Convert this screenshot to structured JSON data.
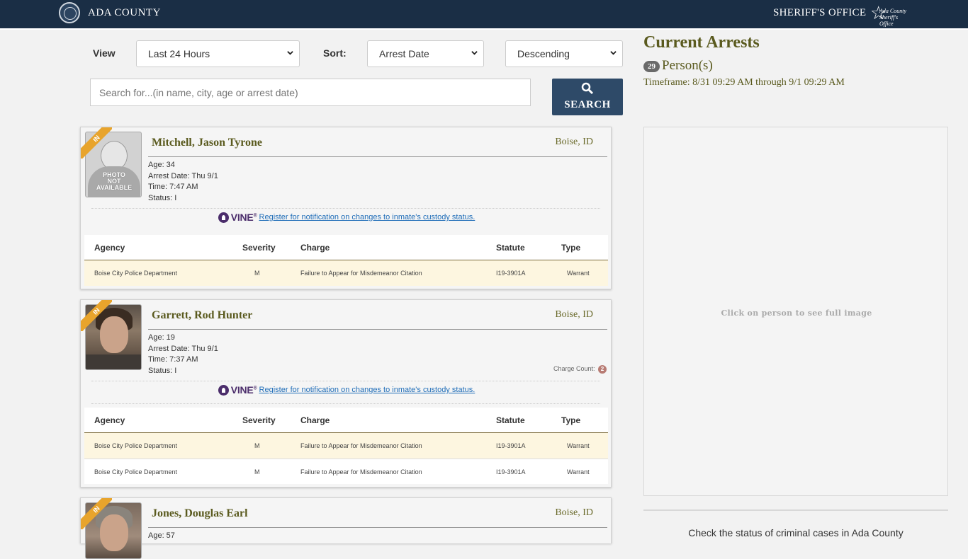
{
  "header": {
    "county_name": "ADA COUNTY",
    "office_name": "SHERIFF'S OFFICE",
    "office_logo_line1": "Ada County",
    "office_logo_line2": "Sheriff's Office"
  },
  "controls": {
    "view_label": "View",
    "view_value": "Last 24 Hours",
    "sort_label": "Sort:",
    "sort_value": "Arrest Date",
    "order_value": "Descending",
    "search_placeholder": "Search for...(in name, city, age or arrest date)",
    "search_button": "SEARCH"
  },
  "table_headers": {
    "agency": "Agency",
    "severity": "Severity",
    "charge": "Charge",
    "statute": "Statute",
    "type": "Type"
  },
  "vine": {
    "word": "VINE",
    "mark": "®",
    "link": "Register for notification on changes to inmate's custody status."
  },
  "ribbon_text": "IN",
  "photo_na_lines": [
    "PHOTO",
    "NOT",
    "AVAILABLE"
  ],
  "arrests": [
    {
      "name": "Mitchell, Jason Tyrone",
      "city": "Boise, ID",
      "age": "Age: 34",
      "arrest_date": "Arrest Date: Thu 9/1",
      "time": "Time: 7:47 AM",
      "status": "Status: I",
      "charges": [
        {
          "agency": "Boise City Police Department",
          "severity": "M",
          "charge": "Failure to Appear for Misdemeanor Citation",
          "statute": "I19-3901A",
          "type": "Warrant"
        }
      ]
    },
    {
      "name": "Garrett, Rod Hunter",
      "city": "Boise, ID",
      "age": "Age: 19",
      "arrest_date": "Arrest Date: Thu 9/1",
      "time": "Time: 7:37 AM",
      "status": "Status: I",
      "charge_count_label": "Charge Count:",
      "charge_count": "2",
      "charges": [
        {
          "agency": "Boise City Police Department",
          "severity": "M",
          "charge": "Failure to Appear for Misdemeanor Citation",
          "statute": "I19-3901A",
          "type": "Warrant"
        },
        {
          "agency": "Boise City Police Department",
          "severity": "M",
          "charge": "Failure to Appear for Misdemeanor Citation",
          "statute": "I19-3901A",
          "type": "Warrant"
        }
      ]
    },
    {
      "name": "Jones, Douglas Earl",
      "city": "Boise, ID",
      "age": "Age: 57"
    }
  ],
  "right_panel": {
    "title": "Current Arrests",
    "person_count": "29",
    "person_label": "Person(s)",
    "timeframe": "Timeframe: 8/31 09:29 AM through 9/1 09:29 AM",
    "image_hint": "Click on person to see full image",
    "cases_text": "Check the status of criminal cases in Ada County"
  },
  "colors": {
    "header_bg": "#1a2e45",
    "name_color": "#5a5a1e",
    "ribbon": "#e8a42c",
    "search_button_bg": "#2e4a68",
    "alt_row": "#fdf6e0"
  }
}
